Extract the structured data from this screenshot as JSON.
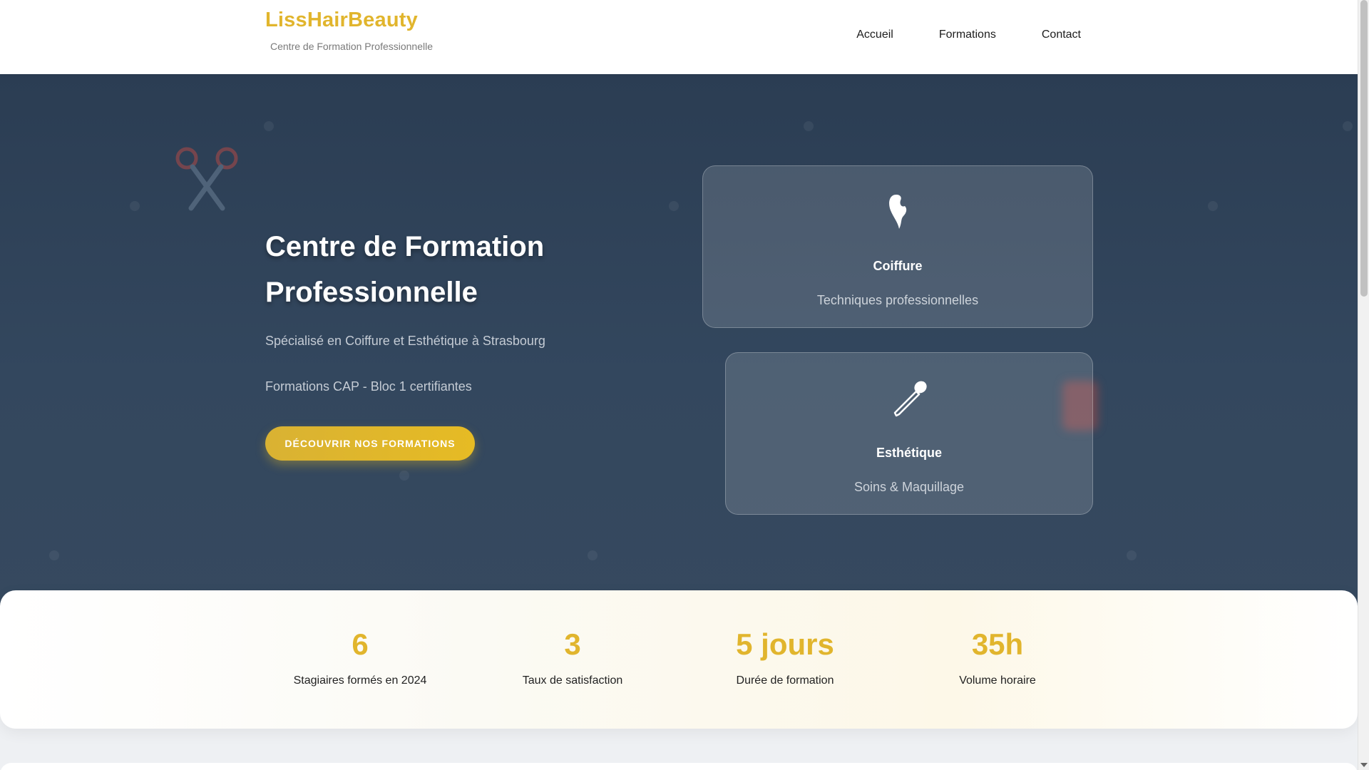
{
  "header": {
    "brand": "LissHairBeauty",
    "tagline": "Centre de Formation Professionnelle",
    "nav": [
      {
        "label": "Accueil"
      },
      {
        "label": "Formations"
      },
      {
        "label": "Contact"
      }
    ]
  },
  "hero": {
    "title": "Centre de Formation Professionnelle",
    "subtitle": "Spécialisé en Coiffure et Esthétique à Strasbourg",
    "subtitle2": "Formations CAP - Bloc 1 certifiantes",
    "cta": "DÉCOUVRIR NOS FORMATIONS",
    "cards": [
      {
        "icon": "hair-icon",
        "title": "Coiffure",
        "text": "Techniques professionnelles"
      },
      {
        "icon": "makeup-brush-icon",
        "title": "Esthétique",
        "text": "Soins & Maquillage"
      }
    ]
  },
  "stats": [
    {
      "value": "6",
      "label": "Stagiaires formés en 2024"
    },
    {
      "value": "3",
      "label": "Taux de satisfaction"
    },
    {
      "value": "5 jours",
      "label": "Durée de formation"
    },
    {
      "value": "35h",
      "label": "Volume horaire"
    }
  ],
  "colors": {
    "accent": "#e1b52d",
    "hero_bg": "#33475e",
    "white": "#ffffff"
  }
}
